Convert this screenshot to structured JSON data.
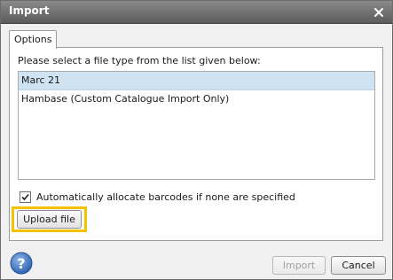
{
  "window": {
    "title": "Import"
  },
  "tabs": [
    {
      "label": "Options"
    }
  ],
  "options": {
    "instruction": "Please select a file type from the list given below:",
    "file_types": [
      {
        "label": "Marc 21",
        "selected": true
      },
      {
        "label": "Hambase (Custom Catalogue Import Only)",
        "selected": false
      }
    ],
    "auto_barcode": {
      "label": "Automatically allocate barcodes if none are specified",
      "checked": true
    },
    "upload_label": "Upload file"
  },
  "footer": {
    "import_label": "Import",
    "import_enabled": false,
    "cancel_label": "Cancel",
    "help_icon": "help-icon"
  },
  "colors": {
    "highlight": "#f5c200",
    "selection": "#cfe3f3",
    "titlebar": "#6e6e6e"
  }
}
